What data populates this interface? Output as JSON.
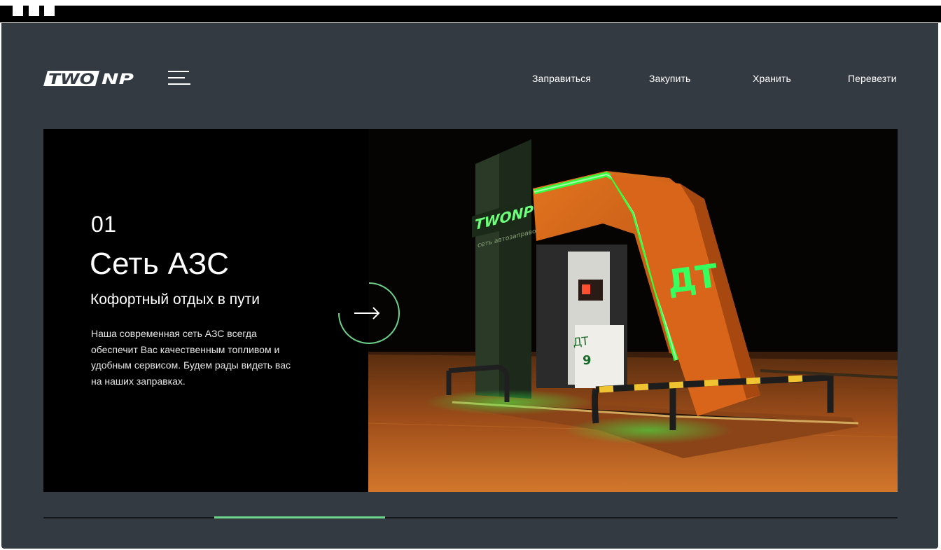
{
  "brand": {
    "logo_text_left": "TWO",
    "logo_text_right": "NP",
    "accent_color": "#6bd38a",
    "background_color": "#333a42"
  },
  "nav": {
    "items": [
      "Заправиться",
      "Закупить",
      "Хранить",
      "Перевезти"
    ]
  },
  "menu_icon": "hamburger-icon",
  "hero": {
    "number": "01",
    "title": "Сеть АЗС",
    "subtitle": "Кофортный отдых в пути",
    "description": "Наша современная сеть АЗС всегда обеспечит Вас качественным топливом и удобным сервисом. Будем рады видеть вас на наших заправках.",
    "next_icon": "arrow-right-icon",
    "photo": {
      "sign_text": "ДТ",
      "pump_text": "ДТ",
      "pump_number": "9",
      "canopy_brand": "TWONP",
      "canopy_caption": "сеть автозаправок"
    }
  },
  "slider": {
    "total_slides": 5,
    "active_index": 1
  }
}
